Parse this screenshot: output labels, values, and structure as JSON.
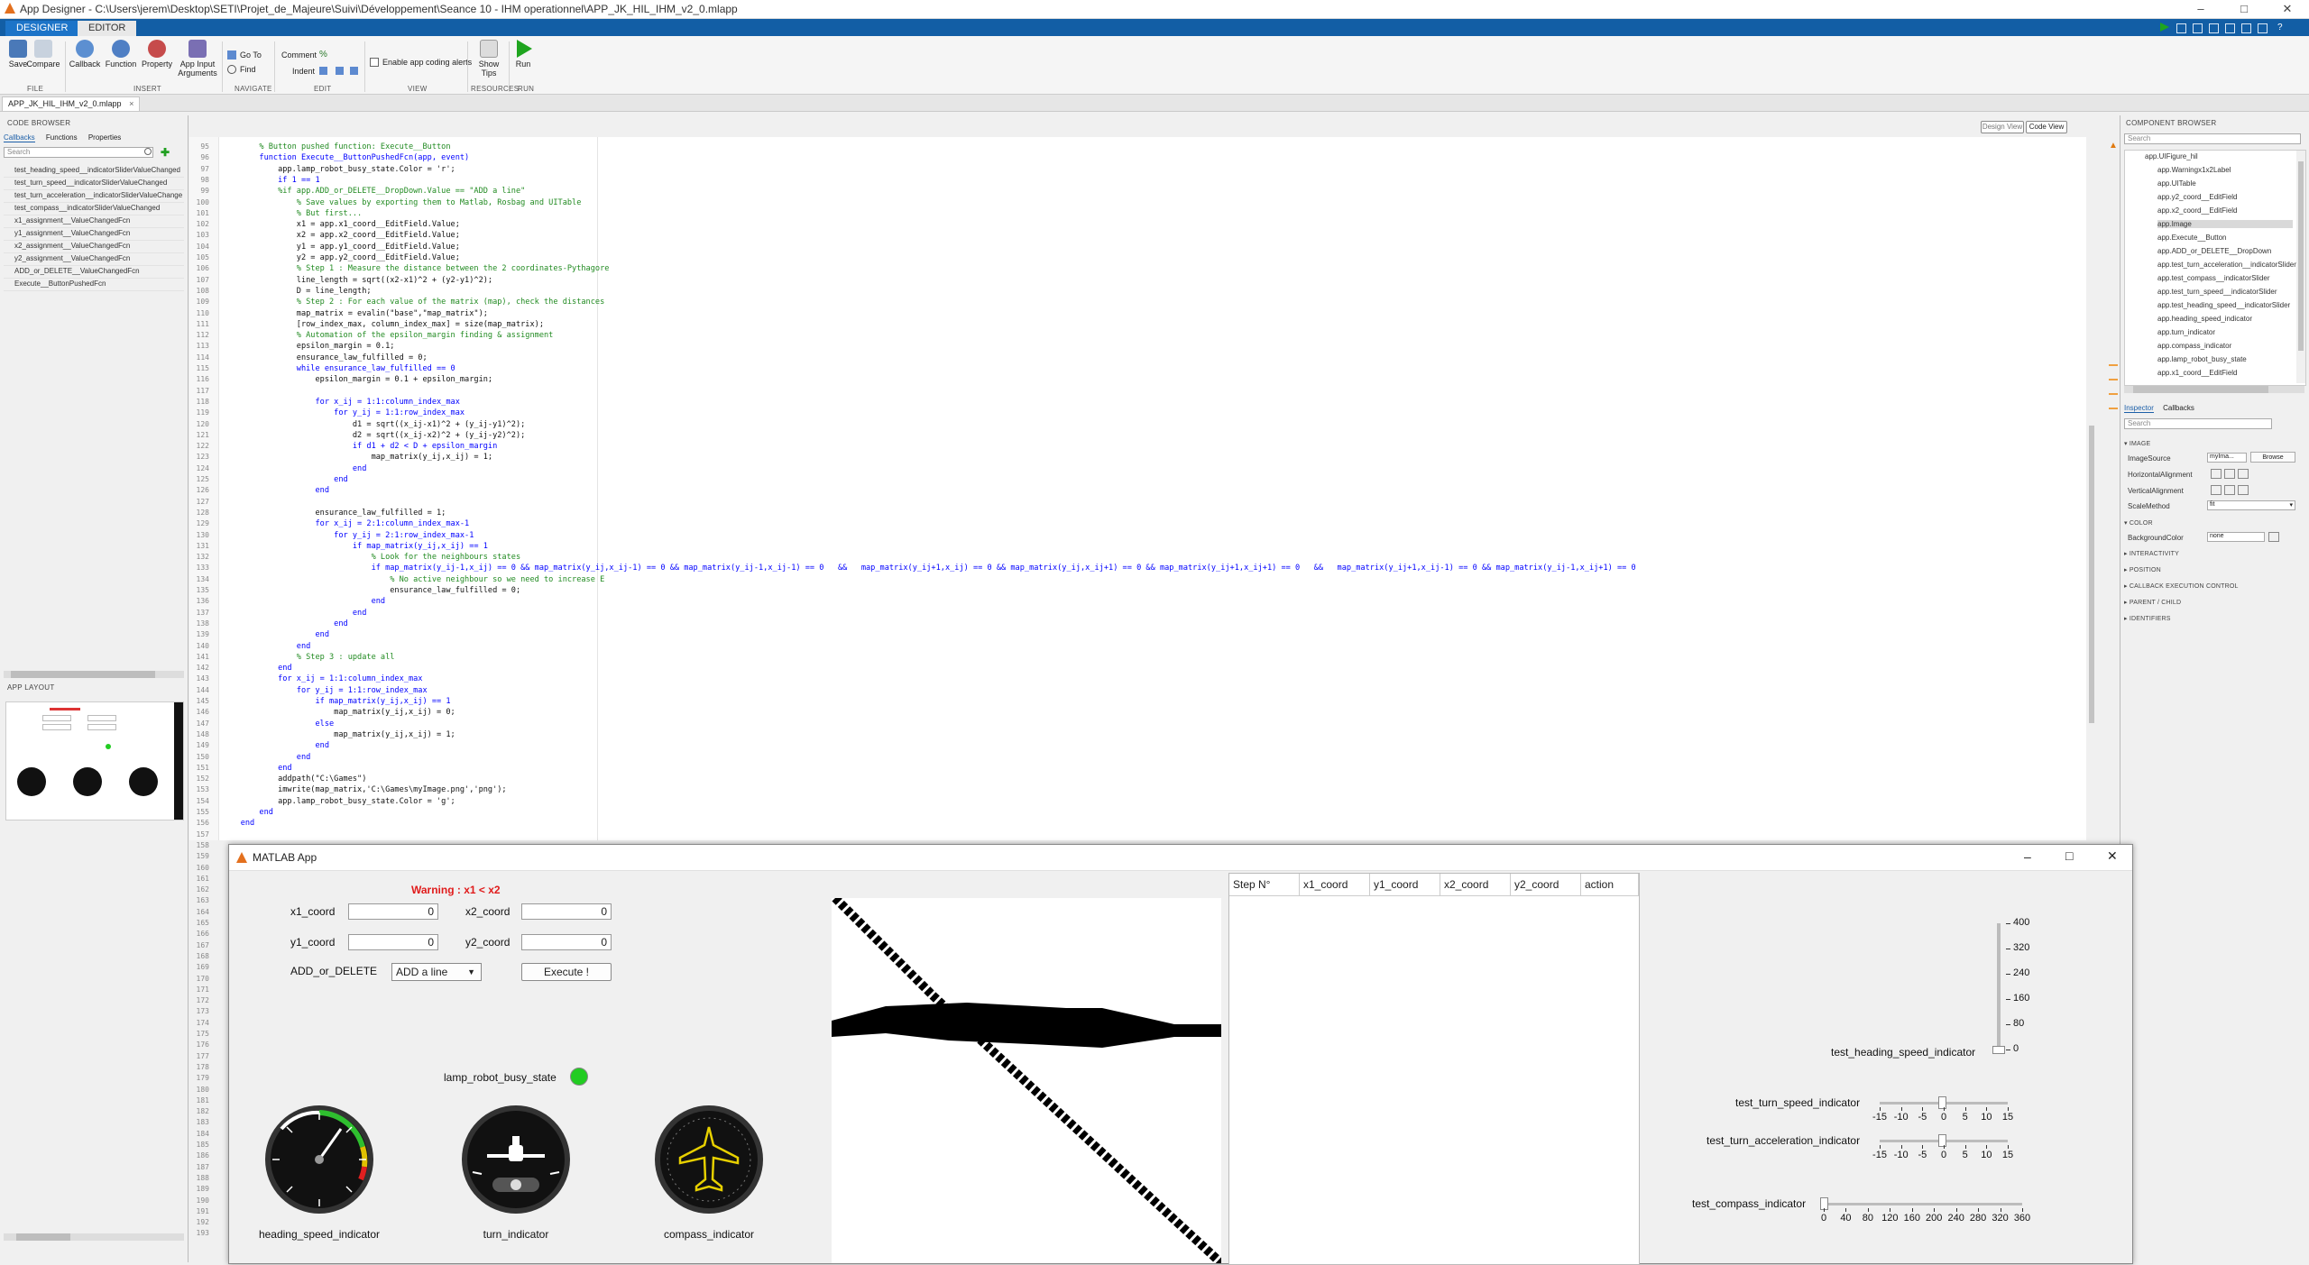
{
  "window": {
    "title": "App Designer - C:\\Users\\jerem\\Desktop\\SETI\\Projet_de_Majeure\\Suivi\\Développement\\Seance 10 - IHM operationnel\\APP_JK_HIL_IHM_v2_0.mlapp"
  },
  "ribbon": {
    "tabs": [
      "DESIGNER",
      "EDITOR"
    ],
    "buttons": {
      "save": "Save",
      "compare": "Compare",
      "callback": "Callback",
      "function": "Function",
      "property": "Property",
      "app_input": "App Input Arguments",
      "goto": "Go To",
      "find": "Find",
      "comment": "Comment",
      "indent": "Indent",
      "coding_alerts": "Enable app coding alerts",
      "show_tips": "Show Tips",
      "run": "Run"
    },
    "sections": [
      "FILE",
      "INSERT",
      "NAVIGATE",
      "EDIT",
      "VIEW",
      "RESOURCES",
      "RUN"
    ]
  },
  "doc_tab": "APP_JK_HIL_IHM_v2_0.mlapp",
  "view_toggle": {
    "design": "Design View",
    "code": "Code View"
  },
  "code_browser": {
    "title": "CODE BROWSER",
    "tabs": [
      "Callbacks",
      "Functions",
      "Properties"
    ],
    "search_placeholder": "Search",
    "items": [
      "test_heading_speed__indicatorSliderValueChanged",
      "test_turn_speed__indicatorSliderValueChanged",
      "test_turn_acceleration__indicatorSliderValueChange",
      "test_compass__indicatorSliderValueChanged",
      "x1_assignment__ValueChangedFcn",
      "y1_assignment__ValueChangedFcn",
      "x2_assignment__ValueChangedFcn",
      "y2_assignment__ValueChangedFcn",
      "ADD_or_DELETE__ValueChangedFcn",
      "Execute__ButtonPushedFcn"
    ]
  },
  "app_layout": {
    "title": "APP LAYOUT"
  },
  "code_lines": [
    {
      "n": "95",
      "t": "        % Button pushed function: Execute__Button",
      "c": "cm"
    },
    {
      "n": "96",
      "t": "        function Execute__ButtonPushedFcn(app, event)",
      "c": "kw"
    },
    {
      "n": "97",
      "t": "            app.lamp_robot_busy_state.Color = 'r';",
      "c": ""
    },
    {
      "n": "98",
      "t": "            if 1 == 1",
      "c": "kw"
    },
    {
      "n": "99",
      "t": "            %if app.ADD_or_DELETE__DropDown.Value == \"ADD a line\"",
      "c": "cm"
    },
    {
      "n": "100",
      "t": "                % Save values by exporting them to Matlab, Rosbag and UITable",
      "c": "cm"
    },
    {
      "n": "101",
      "t": "                % But first...",
      "c": "cm"
    },
    {
      "n": "102",
      "t": "                x1 = app.x1_coord__EditField.Value;",
      "c": ""
    },
    {
      "n": "103",
      "t": "                x2 = app.x2_coord__EditField.Value;",
      "c": ""
    },
    {
      "n": "104",
      "t": "                y1 = app.y1_coord__EditField.Value;",
      "c": ""
    },
    {
      "n": "105",
      "t": "                y2 = app.y2_coord__EditField.Value;",
      "c": ""
    },
    {
      "n": "106",
      "t": "                % Step 1 : Measure the distance between the 2 coordinates-Pythagore",
      "c": "cm"
    },
    {
      "n": "107",
      "t": "                line_length = sqrt((x2-x1)^2 + (y2-y1)^2);",
      "c": ""
    },
    {
      "n": "108",
      "t": "                D = line_length;",
      "c": ""
    },
    {
      "n": "109",
      "t": "                % Step 2 : For each value of the matrix (map), check the distances",
      "c": "cm"
    },
    {
      "n": "110",
      "t": "                map_matrix = evalin(\"base\",\"map_matrix\");",
      "c": ""
    },
    {
      "n": "111",
      "t": "                [row_index_max, column_index_max] = size(map_matrix);",
      "c": ""
    },
    {
      "n": "112",
      "t": "                % Automation of the epsilon_margin finding & assignment",
      "c": "cm"
    },
    {
      "n": "113",
      "t": "                epsilon_margin = 0.1;",
      "c": ""
    },
    {
      "n": "114",
      "t": "                ensurance_law_fulfilled = 0;",
      "c": ""
    },
    {
      "n": "115",
      "t": "                while ensurance_law_fulfilled == 0",
      "c": "kw"
    },
    {
      "n": "116",
      "t": "                    epsilon_margin = 0.1 + epsilon_margin;",
      "c": ""
    },
    {
      "n": "117",
      "t": "",
      "c": ""
    },
    {
      "n": "118",
      "t": "                    for x_ij = 1:1:column_index_max",
      "c": "kw"
    },
    {
      "n": "119",
      "t": "                        for y_ij = 1:1:row_index_max",
      "c": "kw"
    },
    {
      "n": "120",
      "t": "                            d1 = sqrt((x_ij-x1)^2 + (y_ij-y1)^2);",
      "c": ""
    },
    {
      "n": "121",
      "t": "                            d2 = sqrt((x_ij-x2)^2 + (y_ij-y2)^2);",
      "c": ""
    },
    {
      "n": "122",
      "t": "                            if d1 + d2 < D + epsilon_margin",
      "c": "kw"
    },
    {
      "n": "123",
      "t": "                                map_matrix(y_ij,x_ij) = 1;",
      "c": ""
    },
    {
      "n": "124",
      "t": "                            end",
      "c": "kw"
    },
    {
      "n": "125",
      "t": "                        end",
      "c": "kw"
    },
    {
      "n": "126",
      "t": "                    end",
      "c": "kw"
    },
    {
      "n": "127",
      "t": "",
      "c": ""
    },
    {
      "n": "128",
      "t": "                    ensurance_law_fulfilled = 1;",
      "c": ""
    },
    {
      "n": "129",
      "t": "                    for x_ij = 2:1:column_index_max-1",
      "c": "kw"
    },
    {
      "n": "130",
      "t": "                        for y_ij = 2:1:row_index_max-1",
      "c": "kw"
    },
    {
      "n": "131",
      "t": "                            if map_matrix(y_ij,x_ij) == 1",
      "c": "kw"
    },
    {
      "n": "132",
      "t": "                                % Look for the neighbours states",
      "c": "cm"
    },
    {
      "n": "133",
      "t": "                                if map_matrix(y_ij-1,x_ij) == 0 && map_matrix(y_ij,x_ij-1) == 0 && map_matrix(y_ij-1,x_ij-1) == 0   &&   map_matrix(y_ij+1,x_ij) == 0 && map_matrix(y_ij,x_ij+1) == 0 && map_matrix(y_ij+1,x_ij+1) == 0   &&   map_matrix(y_ij+1,x_ij-1) == 0 && map_matrix(y_ij-1,x_ij+1) == 0",
      "c": "kw"
    },
    {
      "n": "134",
      "t": "                                    % No active neighbour so we need to increase E",
      "c": "cm"
    },
    {
      "n": "135",
      "t": "                                    ensurance_law_fulfilled = 0;",
      "c": ""
    },
    {
      "n": "136",
      "t": "                                end",
      "c": "kw"
    },
    {
      "n": "137",
      "t": "                            end",
      "c": "kw"
    },
    {
      "n": "138",
      "t": "                        end",
      "c": "kw"
    },
    {
      "n": "139",
      "t": "                    end",
      "c": "kw"
    },
    {
      "n": "140",
      "t": "                end",
      "c": "kw"
    },
    {
      "n": "141",
      "t": "                % Step 3 : update all",
      "c": "cm"
    },
    {
      "n": "142",
      "t": "            end",
      "c": "kw"
    },
    {
      "n": "143",
      "t": "            for x_ij = 1:1:column_index_max",
      "c": "kw"
    },
    {
      "n": "144",
      "t": "                for y_ij = 1:1:row_index_max",
      "c": "kw"
    },
    {
      "n": "145",
      "t": "                    if map_matrix(y_ij,x_ij) == 1",
      "c": "kw"
    },
    {
      "n": "146",
      "t": "                        map_matrix(y_ij,x_ij) = 0;",
      "c": ""
    },
    {
      "n": "147",
      "t": "                    else",
      "c": "kw"
    },
    {
      "n": "148",
      "t": "                        map_matrix(y_ij,x_ij) = 1;",
      "c": ""
    },
    {
      "n": "149",
      "t": "                    end",
      "c": "kw"
    },
    {
      "n": "150",
      "t": "                end",
      "c": "kw"
    },
    {
      "n": "151",
      "t": "            end",
      "c": "kw"
    },
    {
      "n": "152",
      "t": "            addpath(\"C:\\Games\")",
      "c": ""
    },
    {
      "n": "153",
      "t": "            imwrite(map_matrix,'C:\\Games\\myImage.png','png');",
      "c": ""
    },
    {
      "n": "154",
      "t": "            app.lamp_robot_busy_state.Color = 'g';",
      "c": ""
    },
    {
      "n": "155",
      "t": "        end",
      "c": "kw"
    },
    {
      "n": "156",
      "t": "    end",
      "c": "kw"
    }
  ],
  "extra_line_numbers": [
    "157",
    "158",
    "159",
    "160",
    "161",
    "162",
    "163",
    "164",
    "165",
    "166",
    "167",
    "168",
    "169",
    "170",
    "171",
    "172",
    "173",
    "174",
    "175",
    "176",
    "177",
    "178",
    "179",
    "180",
    "181",
    "182",
    "183",
    "184",
    "185",
    "186",
    "187",
    "188",
    "189",
    "190",
    "191",
    "192",
    "193"
  ],
  "component_browser": {
    "title": "COMPONENT BROWSER",
    "search_placeholder": "Search",
    "items": [
      "app.UIFigure_hil",
      "app.Warningx1x2Label",
      "app.UITable",
      "app.y2_coord__EditField",
      "app.x2_coord__EditField",
      "app.Image",
      "app.Execute__Button",
      "app.ADD_or_DELETE__DropDown",
      "app.test_turn_acceleration__indicatorSlider",
      "app.test_compass__indicatorSlider",
      "app.test_turn_speed__indicatorSlider",
      "app.test_heading_speed__indicatorSlider",
      "app.heading_speed_indicator",
      "app.turn_indicator",
      "app.compass_indicator",
      "app.lamp_robot_busy_state",
      "app.x1_coord__EditField"
    ],
    "selected": "app.Image",
    "inspector_tabs": [
      "Inspector",
      "Callbacks"
    ],
    "sections": [
      "IMAGE",
      "COLOR",
      "INTERACTIVITY",
      "POSITION",
      "CALLBACK EXECUTION CONTROL",
      "PARENT / CHILD",
      "IDENTIFIERS"
    ],
    "props": [
      {
        "name": "ImageSource",
        "value": "myIma..."
      },
      {
        "name": "HorizontalAlignment",
        "value": ""
      },
      {
        "name": "VerticalAlignment",
        "value": ""
      },
      {
        "name": "ScaleMethod",
        "value": "fit"
      },
      {
        "name": "BackgroundColor",
        "value": "none"
      }
    ],
    "browse_label": "Browse"
  },
  "app": {
    "title": "MATLAB App",
    "warning": "Warning : x1 < x2",
    "x1_label": "x1_coord",
    "x1_value": "0",
    "x2_label": "x2_coord",
    "x2_value": "0",
    "y1_label": "y1_coord",
    "y1_value": "0",
    "y2_label": "y2_coord",
    "y2_value": "0",
    "add_delete_label": "ADD_or_DELETE",
    "add_delete_value": "ADD a line",
    "execute_label": "Execute !",
    "lamp_label": "lamp_robot_busy_state",
    "lamp_color": "#22cc22",
    "gauge_labels": [
      "heading_speed_indicator",
      "turn_indicator",
      "compass_indicator"
    ],
    "table_headers": [
      "Step N°",
      "x1_coord",
      "y1_coord",
      "x2_coord",
      "y2_coord",
      "action"
    ],
    "sliders": {
      "heading_label": "test_heading_speed_indicator",
      "heading_ticks": [
        "400",
        "320",
        "240",
        "160",
        "80",
        "0"
      ],
      "turn_speed_label": "test_turn_speed_indicator",
      "turn_accel_label": "test_turn_acceleration_indicator",
      "turn_ticks": [
        "-15",
        "-10",
        "-5",
        "0",
        "5",
        "10",
        "15"
      ],
      "compass_label": "test_compass_indicator",
      "compass_ticks": [
        "0",
        "40",
        "80",
        "120",
        "160",
        "200",
        "240",
        "280",
        "320",
        "360"
      ]
    }
  }
}
